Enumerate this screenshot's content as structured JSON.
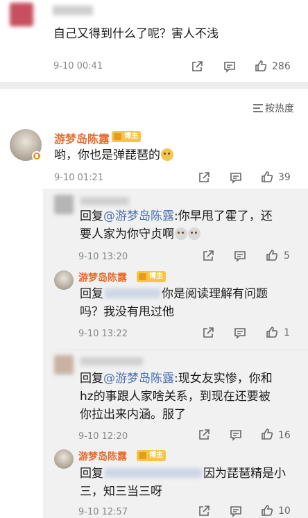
{
  "top_comment": {
    "text": "自己又得到什么了呢？害人不浅",
    "timestamp": "9-10 00:41",
    "like_count": "286"
  },
  "sort": {
    "label": "按热度"
  },
  "comments": [
    {
      "user": "游梦岛陈露",
      "badge": "博主",
      "text": "哟，你也是弹琵琶的",
      "timestamp": "9-10 01:21",
      "like_count": "39"
    }
  ],
  "replies": [
    {
      "prefix": "回复",
      "mention": "@游梦岛陈露",
      "text_line1": ":你早甩了霍了，还",
      "text_line2": "要人家为你守贞啊",
      "timestamp": "9-10 13:20",
      "like_count": "5"
    },
    {
      "user": "游梦岛陈露",
      "badge": "博主",
      "prefix": "回复",
      "text_line1": "你是阅读理解有问题",
      "text_line2": "吗？我没有甩过他",
      "timestamp": "9-10 13:22",
      "like_count": "1"
    },
    {
      "prefix": "回复",
      "mention": "@游梦岛陈露",
      "text_line1": ":现女友实惨，你和",
      "text_line2": "hz的事跟人家啥关系，到现在还要被",
      "text_line3": "你拉出来内涵。服了",
      "timestamp": "9-10 12:20",
      "like_count": "16"
    },
    {
      "user": "游梦岛陈露",
      "badge": "博主",
      "prefix": "回复",
      "text_line1": "因为琵琶精是小",
      "text_line2": "三，知三当三呀",
      "timestamp": "9-10 12:57",
      "like_count": "10"
    }
  ]
}
